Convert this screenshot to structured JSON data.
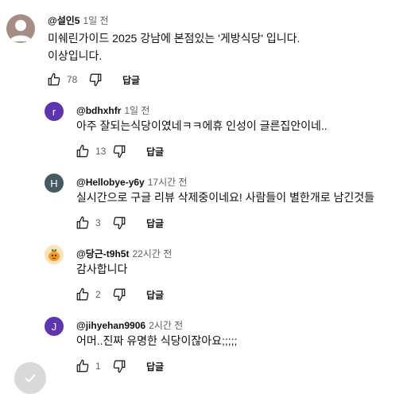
{
  "colors": {
    "avatar_r": "#5e35b1",
    "avatar_h": "#455a64",
    "avatar_j": "#5e35b1",
    "avatar_top": "#a38d84",
    "avatar_dang": "#fbe2b8"
  },
  "comments": [
    {
      "author": "@설인5",
      "time": "1일 전",
      "lines": [
        "미쉐린가이드 2025 강남에 본점있는 '게방식당' 입니다.",
        "이상입니다."
      ],
      "likes": "78",
      "reply_label": "답글"
    }
  ],
  "replies": [
    {
      "avatar_letter": "r",
      "author": "@bdhxhfr",
      "time": "1일 전",
      "text": "아주 잘되는식당이였네ㅋㅋ에휴 인성이 글른집안이네..",
      "likes": "13",
      "reply_label": "답글"
    },
    {
      "avatar_letter": "H",
      "author": "@Hellobye-y6y",
      "time": "17시간 전",
      "text": "실시간으로 구글 리뷰 삭제중이네요! 사람들이 별한개로 남긴것들",
      "likes": "3",
      "reply_label": "답글"
    },
    {
      "avatar_letter": "",
      "author": "@당근-t9h5t",
      "time": "22시간 전",
      "text": "감사합니다",
      "likes": "2",
      "reply_label": "답글"
    },
    {
      "avatar_letter": "J",
      "author": "@jihyehan9906",
      "time": "2시간 전",
      "text": "어머..진짜 유명한 식당이잖아요;;;;;",
      "likes": "1",
      "reply_label": "답글"
    }
  ]
}
